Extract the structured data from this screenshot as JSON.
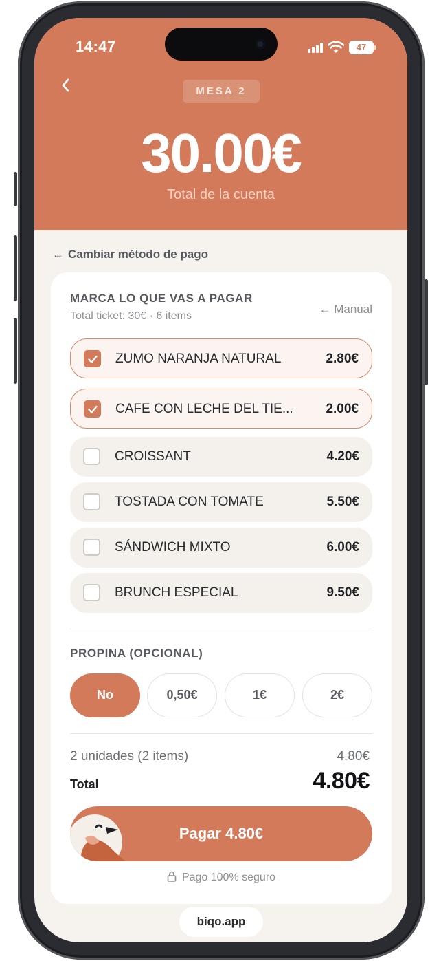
{
  "status_bar": {
    "time": "14:47",
    "battery": "47"
  },
  "header": {
    "table_badge": "MESA 2",
    "total_amount": "30.00€",
    "total_caption": "Total de la cuenta"
  },
  "nav": {
    "change_method": "Cambiar método de pago",
    "change_arrow": "←"
  },
  "card": {
    "title": "MARCA LO QUE VAS A PAGAR",
    "subtitle": "Total ticket: 30€ · 6 items",
    "manual_arrow": "←",
    "manual_label": "Manual",
    "items": [
      {
        "name": "ZUMO NARANJA NATURAL",
        "price": "2.80€",
        "checked": true
      },
      {
        "name": "CAFE CON LECHE DEL TIE...",
        "price": "2.00€",
        "checked": true
      },
      {
        "name": "CROISSANT",
        "price": "4.20€",
        "checked": false
      },
      {
        "name": "TOSTADA CON TOMATE",
        "price": "5.50€",
        "checked": false
      },
      {
        "name": "SÁNDWICH MIXTO",
        "price": "6.00€",
        "checked": false
      },
      {
        "name": "BRUNCH ESPECIAL",
        "price": "9.50€",
        "checked": false
      }
    ]
  },
  "tip": {
    "title": "PROPINA (OPCIONAL)",
    "options": [
      "No",
      "0,50€",
      "1€",
      "2€"
    ],
    "selected": "No"
  },
  "summary": {
    "units_label": "2 unidades (2 items)",
    "subtotal": "4.80€",
    "total_label": "Total",
    "total": "4.80€"
  },
  "pay_button": {
    "label": "Pagar 4.80€"
  },
  "secure_text": "Pago 100% seguro",
  "footer_url": "biqo.app",
  "colors": {
    "accent": "#d27a5a",
    "background": "#f6f3ee",
    "card": "#ffffff"
  }
}
